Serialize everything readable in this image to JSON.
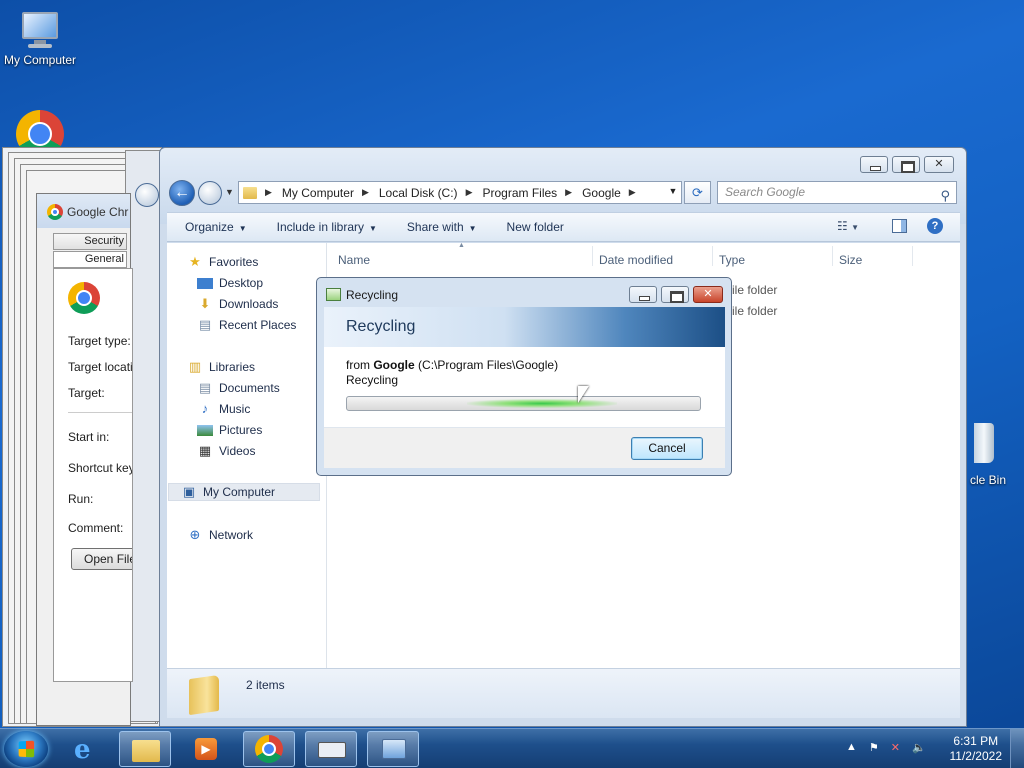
{
  "desktop": {
    "icons": [
      {
        "label": "My Computer",
        "icon": "monitor-icon"
      },
      {
        "label": "",
        "icon": "chrome-icon"
      }
    ],
    "recycle_bin_label": "cle Bin"
  },
  "properties_window": {
    "title": "Google Chr",
    "tabs": [
      "Security",
      "General"
    ],
    "fields": [
      "Target type:",
      "Target locati",
      "Target:",
      "Start in:",
      "Shortcut key",
      "Run:",
      "Comment:"
    ],
    "open_file_button": "Open File"
  },
  "explorer": {
    "breadcrumb": [
      "My Computer",
      "Local Disk (C:)",
      "Program Files",
      "Google"
    ],
    "search_placeholder": "Search Google",
    "toolbar": {
      "organize": "Organize",
      "include_in_library": "Include in library",
      "share_with": "Share with",
      "new_folder": "New folder"
    },
    "nav": {
      "favorites": "Favorites",
      "desktop": "Desktop",
      "downloads": "Downloads",
      "recent_places": "Recent Places",
      "libraries": "Libraries",
      "documents": "Documents",
      "music": "Music",
      "pictures": "Pictures",
      "videos": "Videos",
      "my_computer": "My Computer",
      "network": "Network"
    },
    "columns": [
      "Name",
      "Date modified",
      "Type",
      "Size"
    ],
    "rows": [
      {
        "type": "ile folder"
      },
      {
        "type": "ile folder"
      }
    ],
    "status": "2 items"
  },
  "dialog": {
    "title": "Recycling",
    "heading": "Recycling",
    "from_prefix": "from",
    "from_name": "Google",
    "from_path": "(C:\\Program Files\\Google)",
    "status": "Recycling",
    "cancel": "Cancel"
  },
  "taskbar": {
    "time": "6:31 PM",
    "date": "11/2/2022"
  }
}
